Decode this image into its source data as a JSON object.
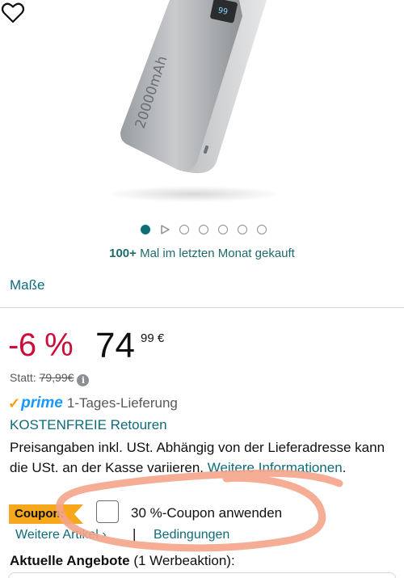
{
  "product": {
    "capacity_label": "20000mAh"
  },
  "carousel": {
    "dot_count": 7,
    "active_index": 0,
    "video_index": 1
  },
  "social_proof": {
    "bold": "100+",
    "text": " Mal im letzten Monat gekauft"
  },
  "masse_link": "Maße",
  "price": {
    "discount": "-6 %",
    "whole": "74",
    "fraction": "99 €",
    "statt_label": "Statt: ",
    "old_price": "79,99€",
    "info_icon": "i"
  },
  "delivery": {
    "prime_label": "prime",
    "text": "1-Tages-Lieferung",
    "returns_link": "KOSTENFREIE Retouren"
  },
  "tax": {
    "text": "Preisangaben inkl. USt. Abhängig von der Lieferadresse kann die USt. an der Kasse variieren. ",
    "link": "Weitere Informationen",
    "end": "."
  },
  "coupon": {
    "badge": "Coupon:",
    "text": "30 %-Coupon anwenden",
    "checked": false,
    "more_items": "Weitere Artikel ›",
    "separator": "|",
    "conditions": "Bedingungen"
  },
  "offers": {
    "bold": "Aktuelle Angebote",
    "text": " (1 Werbeaktion):"
  },
  "colors": {
    "link": "#0f6b7a",
    "discount": "#cc0c39",
    "coupon_badge": "#f7a71b",
    "prime_blue": "#1a98ff",
    "annotation_circle": "#f4a58a"
  }
}
